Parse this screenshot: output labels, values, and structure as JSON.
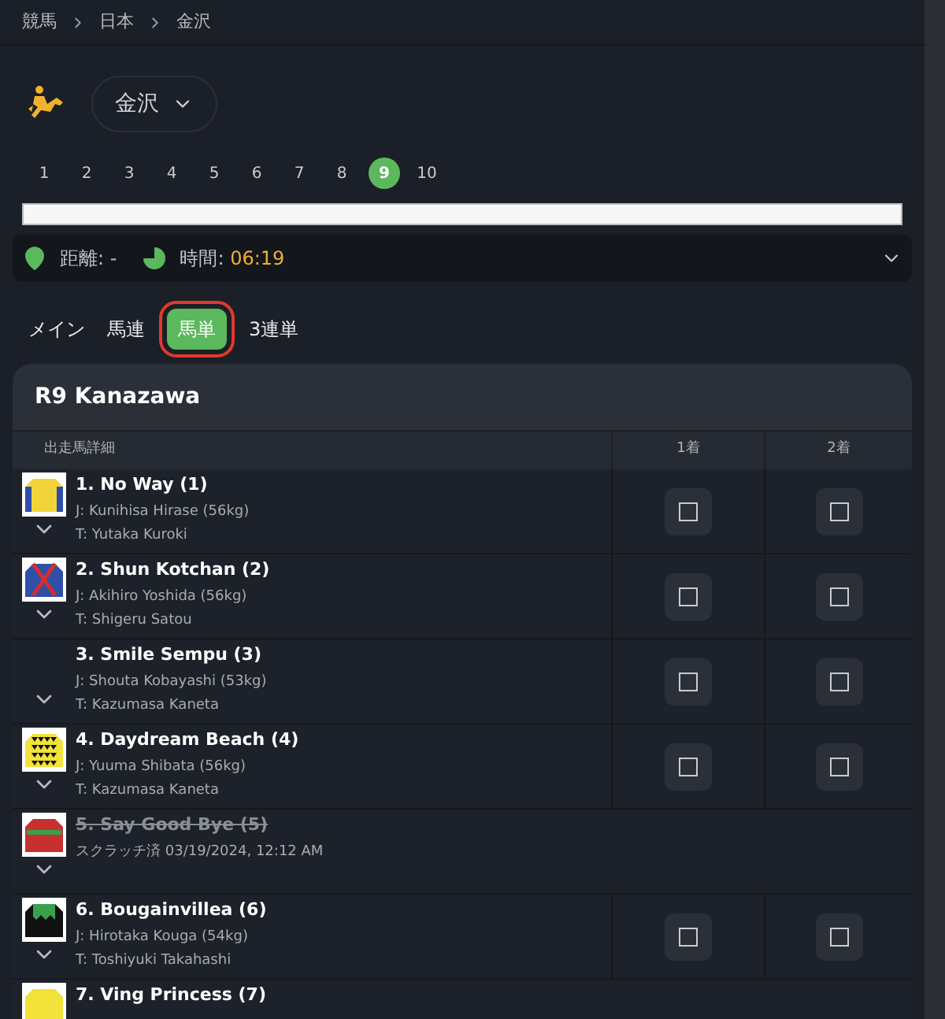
{
  "breadcrumb": [
    "競馬",
    "日本",
    "金沢"
  ],
  "venue": {
    "label": "金沢"
  },
  "races": [
    {
      "label": "1",
      "selected": false
    },
    {
      "label": "2",
      "selected": false
    },
    {
      "label": "3",
      "selected": false
    },
    {
      "label": "4",
      "selected": false
    },
    {
      "label": "5",
      "selected": false
    },
    {
      "label": "6",
      "selected": false
    },
    {
      "label": "7",
      "selected": false
    },
    {
      "label": "8",
      "selected": false
    },
    {
      "label": "9",
      "selected": true
    },
    {
      "label": "10",
      "selected": false
    }
  ],
  "progress": {
    "level": 1
  },
  "info": {
    "distance_label": "距離:",
    "distance_value": "-",
    "time_label": "時間:",
    "time_value": "06:19"
  },
  "bet_tabs": [
    {
      "label": "メイン",
      "selected": false
    },
    {
      "label": "馬連",
      "selected": false
    },
    {
      "label": "馬単",
      "selected": true
    },
    {
      "label": "3連単",
      "selected": false
    }
  ],
  "race_card": {
    "title": "R9 Kanazawa",
    "columns": [
      "出走馬詳細",
      "1着",
      "2着"
    ],
    "rows": [
      {
        "kind": "runner",
        "name": "1. No Way (1)",
        "jockey": "J: Kunihisa Hirase (56kg)",
        "trainer": "T: Yutaka Kuroki",
        "silk": {
          "kind": "sleeves",
          "color": "#f2d43a"
        },
        "picks": [
          {
            "checked": false
          },
          {
            "checked": false
          }
        ]
      },
      {
        "kind": "runner",
        "name": "2. Shun Kotchan (2)",
        "jockey": "J: Akihiro Yoshida (56kg)",
        "trainer": "T: Shigeru Satou",
        "silk": {
          "kind": "cross",
          "color": "#2f4fa8"
        },
        "picks": [
          {
            "checked": false
          },
          {
            "checked": false
          }
        ]
      },
      {
        "kind": "runner",
        "name": "3. Smile Sempu (3)",
        "jockey": "J: Shouta Kobayashi (53kg)",
        "trainer": "T: Kazumasa Kaneta",
        "picks": [
          {
            "checked": false
          },
          {
            "checked": false
          }
        ]
      },
      {
        "kind": "runner",
        "name": "4. Daydream Beach (4)",
        "jockey": "J: Yuuma Shibata (56kg)",
        "trainer": "T: Kazumasa Kaneta",
        "silk": {
          "kind": "triangles",
          "color": "#f2e23a"
        },
        "picks": [
          {
            "checked": false
          },
          {
            "checked": false
          }
        ]
      },
      {
        "kind": "scratched",
        "name": "5. Say Good Bye (5)",
        "note": "スクラッチ済 03/19/2024, 12:12 AM",
        "silk": {
          "kind": "band",
          "color": "#c83030"
        }
      },
      {
        "kind": "runner",
        "name": "6. Bougainvillea (6)",
        "jockey": "J: Hirotaka Kouga (54kg)",
        "trainer": "T: Toshiyuki Takahashi",
        "silk": {
          "kind": "zigzag",
          "color": "#111111"
        },
        "picks": [
          {
            "checked": false
          },
          {
            "checked": false
          }
        ]
      },
      {
        "kind": "partial",
        "name": "7. Ving Princess (7)",
        "silk": {
          "kind": "plain",
          "color": "#f2e23a"
        }
      }
    ]
  }
}
